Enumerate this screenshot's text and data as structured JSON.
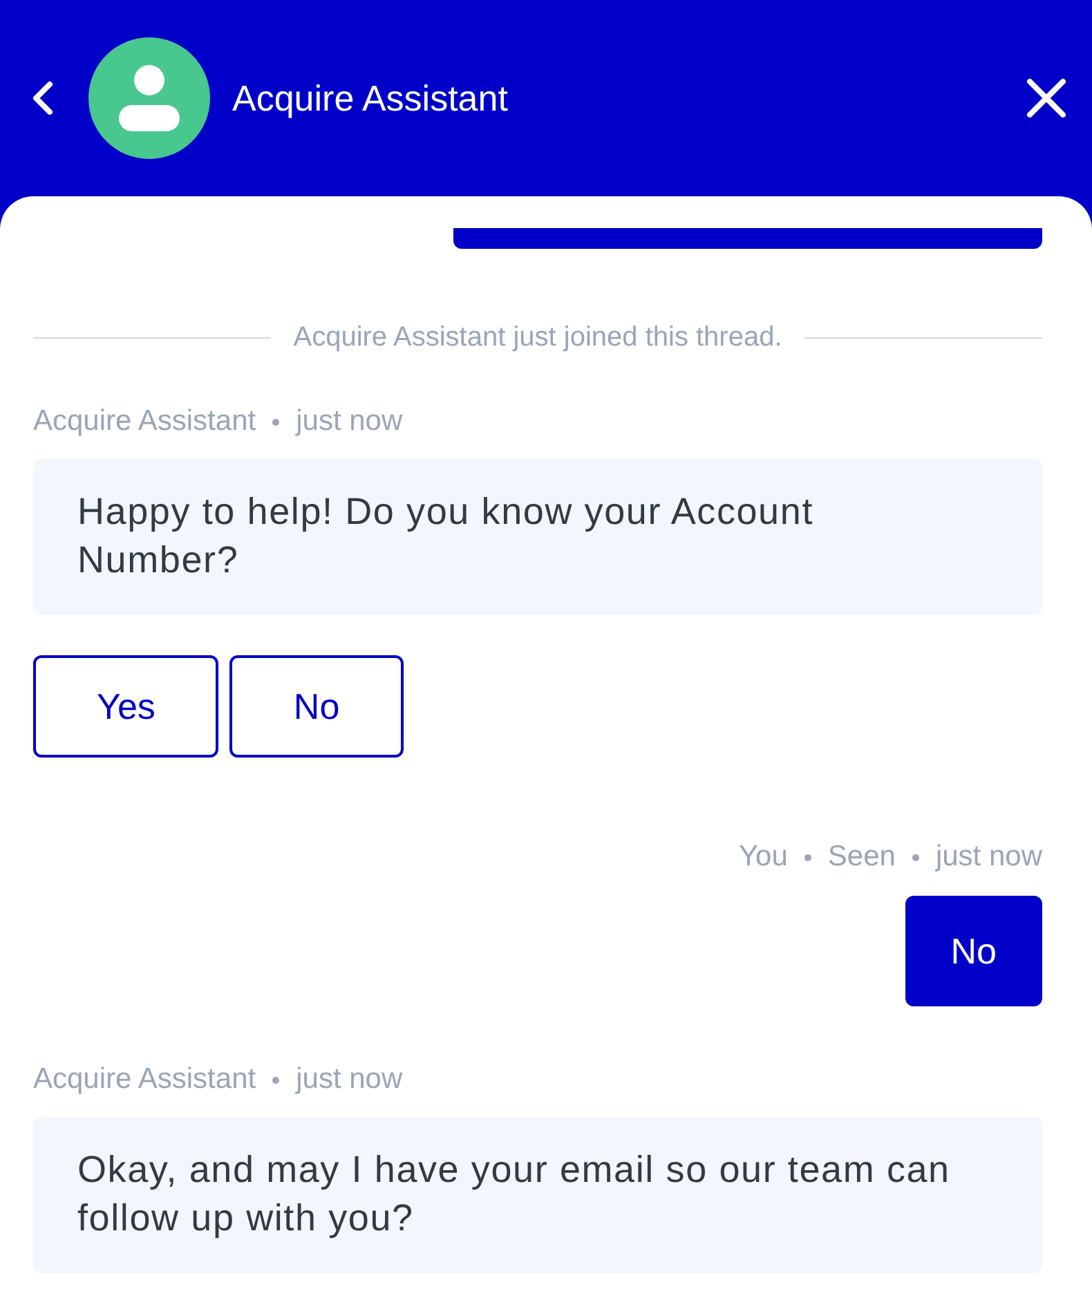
{
  "header": {
    "title": "Acquire Assistant"
  },
  "thread": [
    {
      "kind": "cut_bubble"
    },
    {
      "kind": "notice",
      "text": "Acquire Assistant just joined this thread."
    },
    {
      "kind": "bot_message",
      "meta": [
        "Acquire Assistant",
        "just now"
      ],
      "text": "Happy to help! Do you know your Account Number?"
    },
    {
      "kind": "quick_replies",
      "options": [
        {
          "label": "Yes"
        },
        {
          "label": "No"
        }
      ]
    },
    {
      "kind": "user_message",
      "meta": [
        "You",
        "Seen",
        "just now"
      ],
      "text": "No"
    },
    {
      "kind": "bot_message",
      "meta": [
        "Acquire Assistant",
        "just now"
      ],
      "text": "Okay, and may I have your email so our team can follow up with you?"
    }
  ]
}
